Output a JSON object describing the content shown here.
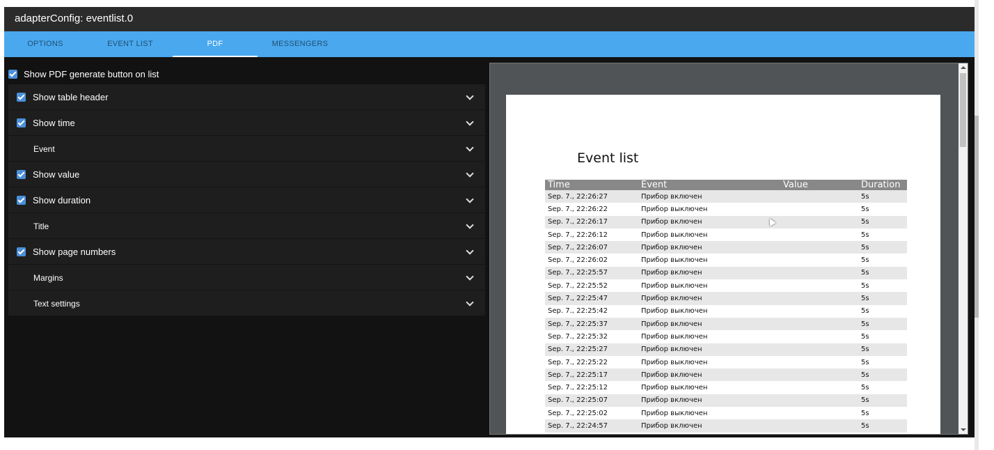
{
  "window": {
    "title": "adapterConfig: eventlist.0"
  },
  "tabs": [
    {
      "label": "OPTIONS",
      "active": false
    },
    {
      "label": "EVENT LIST",
      "active": false
    },
    {
      "label": "PDF",
      "active": true
    },
    {
      "label": "MESSENGERS",
      "active": false
    }
  ],
  "options": {
    "show_pdf_button": {
      "label": "Show PDF generate button on list",
      "checked": true
    }
  },
  "accordion": [
    {
      "label": "Show table header",
      "checked": true
    },
    {
      "label": "Show time",
      "checked": true
    },
    {
      "label": "Event",
      "checked": null
    },
    {
      "label": "Show value",
      "checked": true
    },
    {
      "label": "Show duration",
      "checked": true
    },
    {
      "label": "Title",
      "checked": null
    },
    {
      "label": "Show page numbers",
      "checked": true
    },
    {
      "label": "Margins",
      "checked": null
    },
    {
      "label": "Text settings",
      "checked": null
    }
  ],
  "preview": {
    "doc_title": "Event list",
    "columns": [
      "Time",
      "Event",
      "Value",
      "Duration"
    ],
    "rows": [
      {
        "time": "Sep. 7., 22:26:27",
        "event": "Прибор включен",
        "value": "",
        "duration": "5s"
      },
      {
        "time": "Sep. 7., 22:26:22",
        "event": "Прибор выключен",
        "value": "",
        "duration": "5s"
      },
      {
        "time": "Sep. 7., 22:26:17",
        "event": "Прибор включен",
        "value": "",
        "duration": "5s"
      },
      {
        "time": "Sep. 7., 22:26:12",
        "event": "Прибор выключен",
        "value": "",
        "duration": "5s"
      },
      {
        "time": "Sep. 7., 22:26:07",
        "event": "Прибор включен",
        "value": "",
        "duration": "5s"
      },
      {
        "time": "Sep. 7., 22:26:02",
        "event": "Прибор выключен",
        "value": "",
        "duration": "5s"
      },
      {
        "time": "Sep. 7., 22:25:57",
        "event": "Прибор включен",
        "value": "",
        "duration": "5s"
      },
      {
        "time": "Sep. 7., 22:25:52",
        "event": "Прибор выключен",
        "value": "",
        "duration": "5s"
      },
      {
        "time": "Sep. 7., 22:25:47",
        "event": "Прибор включен",
        "value": "",
        "duration": "5s"
      },
      {
        "time": "Sep. 7., 22:25:42",
        "event": "Прибор выключен",
        "value": "",
        "duration": "5s"
      },
      {
        "time": "Sep. 7., 22:25:37",
        "event": "Прибор включен",
        "value": "",
        "duration": "5s"
      },
      {
        "time": "Sep. 7., 22:25:32",
        "event": "Прибор выключен",
        "value": "",
        "duration": "5s"
      },
      {
        "time": "Sep. 7., 22:25:27",
        "event": "Прибор включен",
        "value": "",
        "duration": "5s"
      },
      {
        "time": "Sep. 7., 22:25:22",
        "event": "Прибор выключен",
        "value": "",
        "duration": "5s"
      },
      {
        "time": "Sep. 7., 22:25:17",
        "event": "Прибор включен",
        "value": "",
        "duration": "5s"
      },
      {
        "time": "Sep. 7., 22:25:12",
        "event": "Прибор выключен",
        "value": "",
        "duration": "5s"
      },
      {
        "time": "Sep. 7., 22:25:07",
        "event": "Прибор включен",
        "value": "",
        "duration": "5s"
      },
      {
        "time": "Sep. 7., 22:25:02",
        "event": "Прибор выключен",
        "value": "",
        "duration": "5s"
      },
      {
        "time": "Sep. 7., 22:24:57",
        "event": "Прибор включен",
        "value": "",
        "duration": "5s"
      }
    ]
  },
  "colors": {
    "tab_bar": "#4aa8ee",
    "title_bar": "#2b2b2b",
    "background": "#121212",
    "checkbox": "#4a90d9",
    "table_header": "#888888",
    "row_alt": "#e7e7e7"
  }
}
